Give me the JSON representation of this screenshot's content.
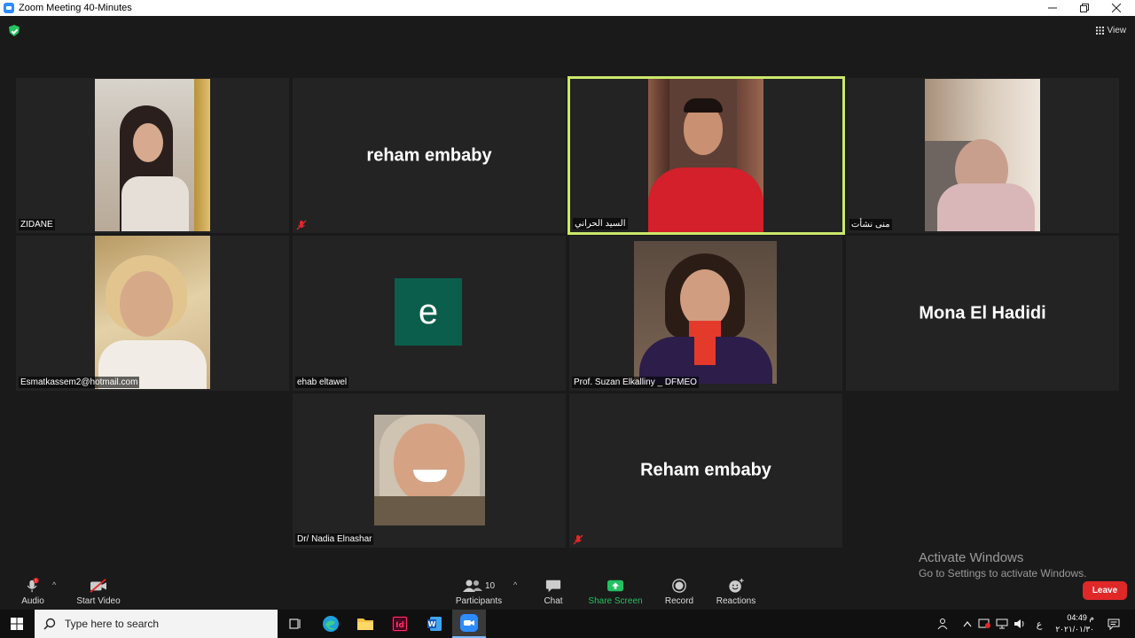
{
  "window": {
    "title": "Zoom Meeting 40-Minutes"
  },
  "header": {
    "view_label": "View"
  },
  "tiles": {
    "zidane": {
      "name": "ZIDANE"
    },
    "reham1": {
      "big_name": "reham embaby"
    },
    "elsayed": {
      "name": "السيد الحراني"
    },
    "mona_nashat": {
      "name": "منى نشأت"
    },
    "esmat": {
      "name": "Esmatkassem2@hotmail.com"
    },
    "ehab": {
      "name": "ehab eltawel",
      "avatar_letter": "e"
    },
    "suzan": {
      "name": "Prof. Suzan Elkalliny _ DFMEO"
    },
    "mona_hadidi": {
      "big_name": "Mona El Hadidi"
    },
    "nadia": {
      "name": "Dr/ Nadia Elnashar"
    },
    "reham2": {
      "big_name": "Reham embaby"
    }
  },
  "watermark": {
    "line1": "Activate Windows",
    "line2": "Go to Settings to activate Windows."
  },
  "toolbar": {
    "audio": "Audio",
    "start_video": "Start Video",
    "participants": "Participants",
    "participants_count": "10",
    "chat": "Chat",
    "share_screen": "Share Screen",
    "record": "Record",
    "reactions": "Reactions",
    "leave": "Leave",
    "audio_badge": "!"
  },
  "taskbar": {
    "search_placeholder": "Type here to search",
    "lang": "ع",
    "time": "04:49 م",
    "date": "٢٠٢١/٠١/٣٠"
  },
  "colors": {
    "active_speaker_border": "#cce86c",
    "share_green": "#23c161",
    "leave_red": "#e02828",
    "avatar_green": "#0b5e4c"
  }
}
